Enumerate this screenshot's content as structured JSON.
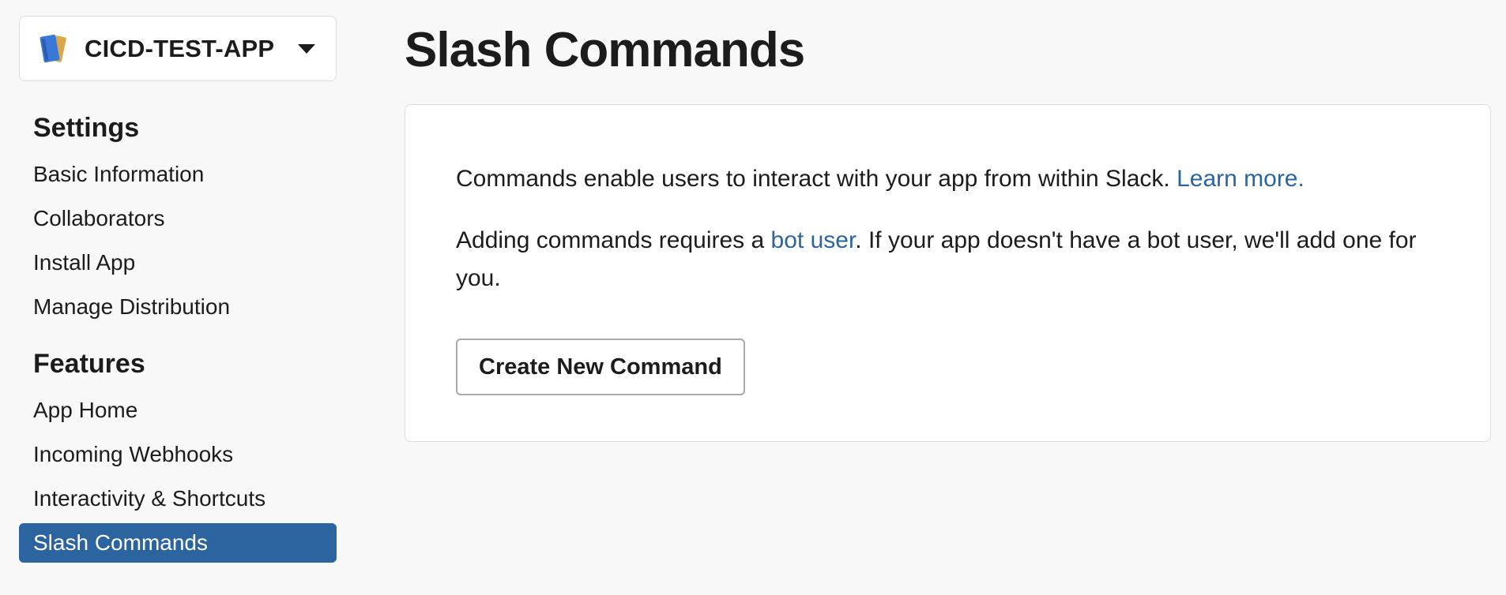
{
  "app": {
    "name": "CICD-TEST-APP",
    "icon": "notebook-icon"
  },
  "sidebar": {
    "settings_title": "Settings",
    "settings_items": [
      {
        "label": "Basic Information"
      },
      {
        "label": "Collaborators"
      },
      {
        "label": "Install App"
      },
      {
        "label": "Manage Distribution"
      }
    ],
    "features_title": "Features",
    "features_items": [
      {
        "label": "App Home"
      },
      {
        "label": "Incoming Webhooks"
      },
      {
        "label": "Interactivity & Shortcuts"
      },
      {
        "label": "Slash Commands",
        "active": true
      }
    ]
  },
  "main": {
    "title": "Slash Commands",
    "intro_text": "Commands enable users to interact with your app from within Slack. ",
    "learn_more": "Learn more.",
    "bot_text_before": "Adding commands requires a ",
    "bot_link": "bot user",
    "bot_text_after": ". If your app doesn't have a bot user, we'll add one for you.",
    "create_button": "Create New Command"
  },
  "colors": {
    "accent": "#2c64a0",
    "background": "#f8f8f8",
    "text": "#1d1c1d"
  }
}
